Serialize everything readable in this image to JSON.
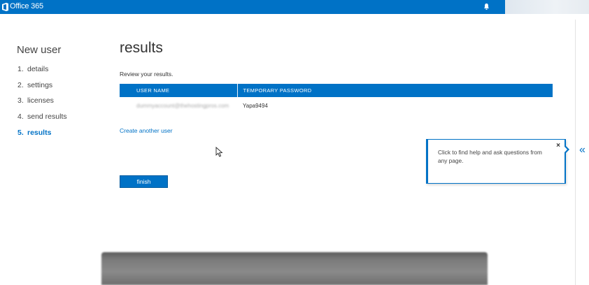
{
  "header": {
    "app_title": "Office 365",
    "logo_icon": "office-logo-icon",
    "bell_icon": "bell-icon",
    "bar_color": "#0072c6"
  },
  "wizard": {
    "title": "New user",
    "steps": [
      {
        "num": "1.",
        "label": "details"
      },
      {
        "num": "2.",
        "label": "settings"
      },
      {
        "num": "3.",
        "label": "licenses"
      },
      {
        "num": "4.",
        "label": "send results"
      },
      {
        "num": "5.",
        "label": "results",
        "active": true
      }
    ]
  },
  "main": {
    "title": "results",
    "review_text": "Review your results.",
    "table": {
      "headers": [
        "USER NAME",
        "TEMPORARY PASSWORD"
      ],
      "rows": [
        {
          "username": "dummyaccount@thehostingpros.com",
          "password": "Yapa9494"
        }
      ]
    },
    "create_link": "Create another user",
    "finish_label": "finish"
  },
  "help_callout": {
    "text": "Click to find help and ask questions from any page.",
    "close_glyph": "×"
  },
  "side_panel": {
    "collapse_glyph": "«"
  },
  "accent_color": "#0072c6"
}
